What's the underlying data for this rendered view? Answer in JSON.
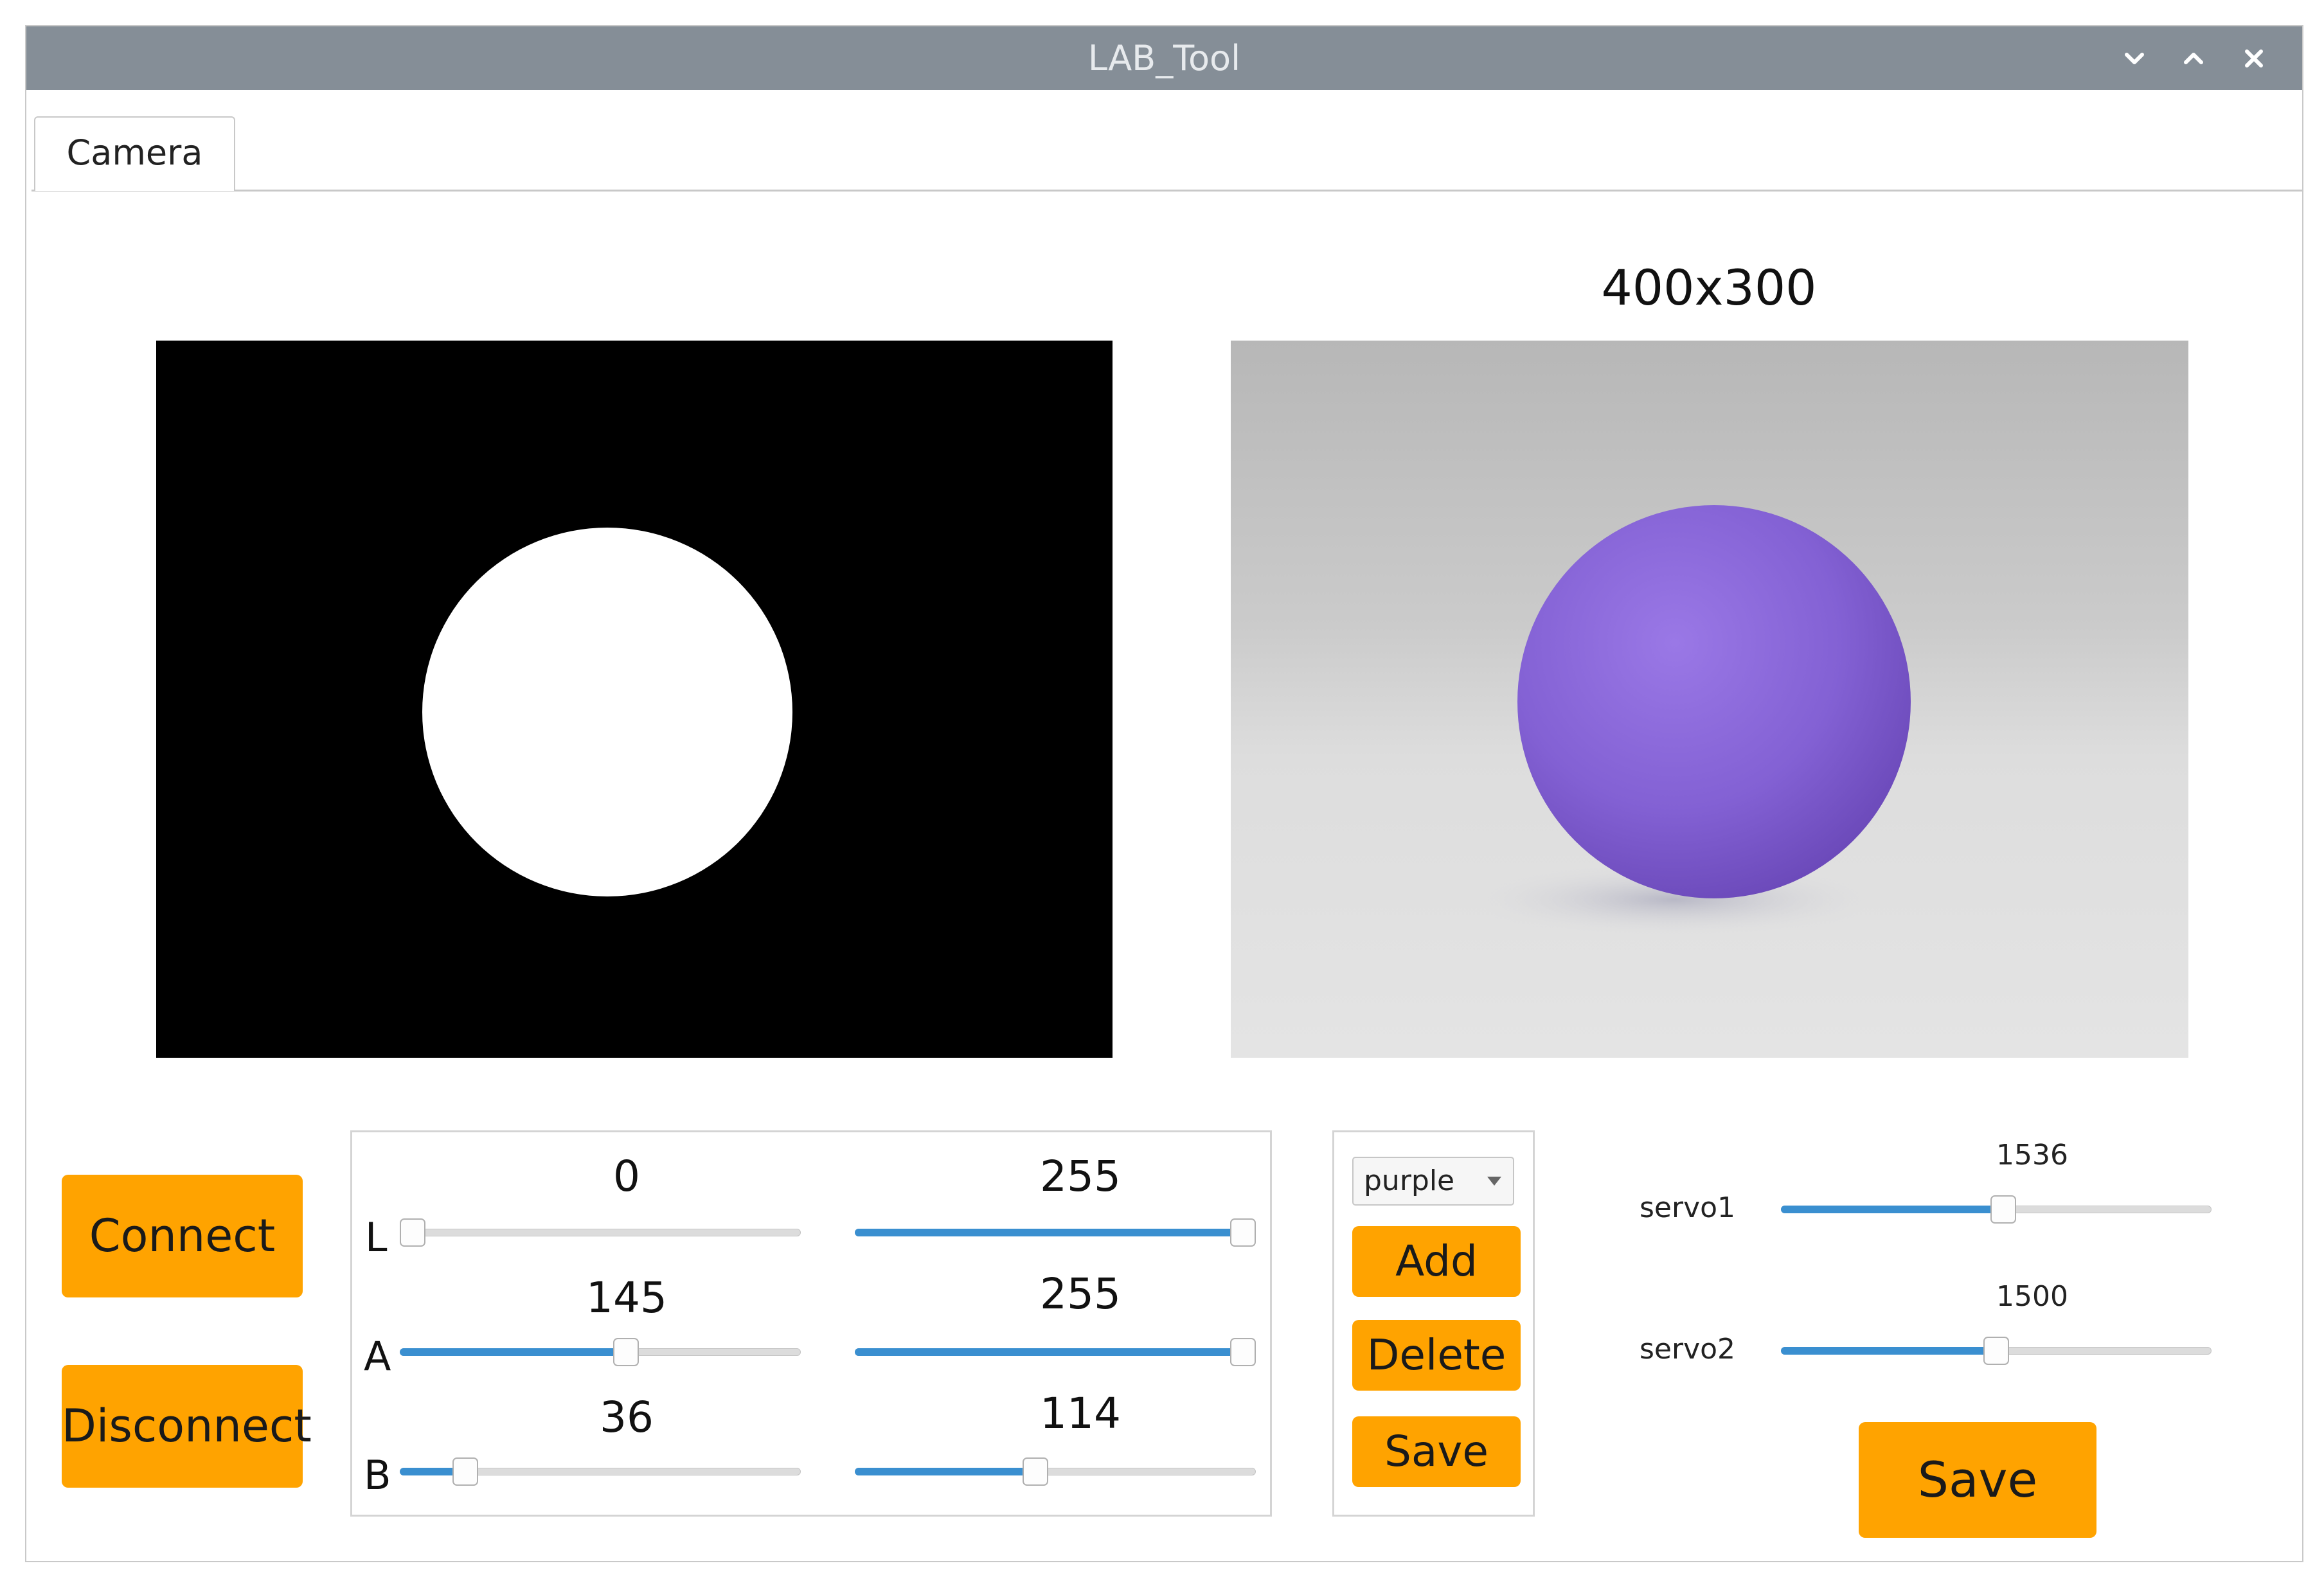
{
  "window": {
    "title": "LAB_Tool"
  },
  "tabs": [
    {
      "label": "Camera"
    }
  ],
  "camera": {
    "resolution": "400x300"
  },
  "buttons": {
    "connect": "Connect",
    "disconnect": "Disconnect"
  },
  "lab": {
    "max_value": 255,
    "rows": [
      {
        "channel": "L",
        "min": "0",
        "max": "255"
      },
      {
        "channel": "A",
        "min": "145",
        "max": "255"
      },
      {
        "channel": "B",
        "min": "36",
        "max": "114"
      }
    ]
  },
  "color": {
    "selected": "purple",
    "add_label": "Add",
    "delete_label": "Delete",
    "save_label": "Save"
  },
  "servos": {
    "range": [
      500,
      2500
    ],
    "items": [
      {
        "label": "servo1",
        "value": "1536"
      },
      {
        "label": "servo2",
        "value": "1500"
      }
    ],
    "save_label": "Save"
  },
  "colors": {
    "accent_button": "#ffa300",
    "slider_fill": "#3a8fd0",
    "titlebar": "#858e97",
    "ball": "#8a64d8"
  }
}
